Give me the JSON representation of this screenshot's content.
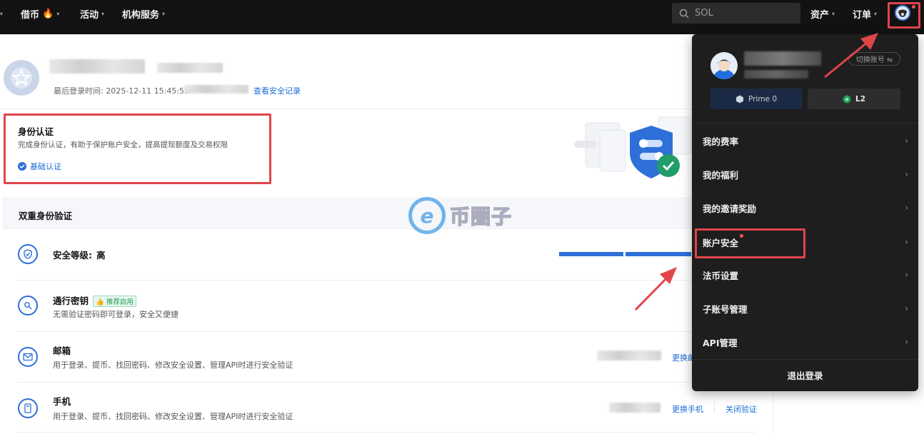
{
  "topbar": {
    "nav": [
      {
        "label": "借币",
        "icon": "fire-icon"
      },
      {
        "label": "活动"
      },
      {
        "label": "机构服务"
      }
    ],
    "search_placeholder": "SOL",
    "assets_label": "资产",
    "orders_label": "订单"
  },
  "profile": {
    "last_login_label": "最后登录时间: 2025-12-11 15:45:58",
    "security_record_link": "查看安全记录"
  },
  "identity": {
    "title": "身份认证",
    "description": "完成身份认证，有助于保护账户安全，提高提现额度及交易权限",
    "level": "基础认证"
  },
  "two_factor": {
    "header": "双重身份验证",
    "security_level_label": "安全等级:",
    "security_level_value": "高",
    "rows": [
      {
        "title": "通行密钥",
        "tag": "推荐启用",
        "desc": "无需验证密码即可登录，安全又便捷"
      },
      {
        "title": "邮箱",
        "desc": "用于登录、提币、找回密码、修改安全设置、管理API时进行安全验证",
        "action": "更换邮"
      },
      {
        "title": "手机",
        "desc": "用于登录、提币、找回密码、修改安全设置、管理API时进行安全验证",
        "action": "更换手机",
        "action2": "关闭验证"
      }
    ]
  },
  "dropdown": {
    "switch_account": "切换账号 ⇋",
    "badges": [
      {
        "label": "Prime 0",
        "icon": "hexagon-icon"
      },
      {
        "label": "L2",
        "icon": "level-badge-icon"
      }
    ],
    "menu": [
      {
        "label": "我的费率"
      },
      {
        "label": "我的福利"
      },
      {
        "label": "我的邀请奖励"
      },
      {
        "label": "账户安全"
      },
      {
        "label": "法币设置"
      },
      {
        "label": "子账号管理"
      },
      {
        "label": "API管理"
      }
    ],
    "logout": "退出登录"
  },
  "watermark": {
    "text": "币圈子"
  },
  "colors": {
    "accent": "#2f6fd8",
    "highlight": "#e0454a",
    "topbar": "#121212",
    "dropdown_bg": "#1e1e1e"
  }
}
